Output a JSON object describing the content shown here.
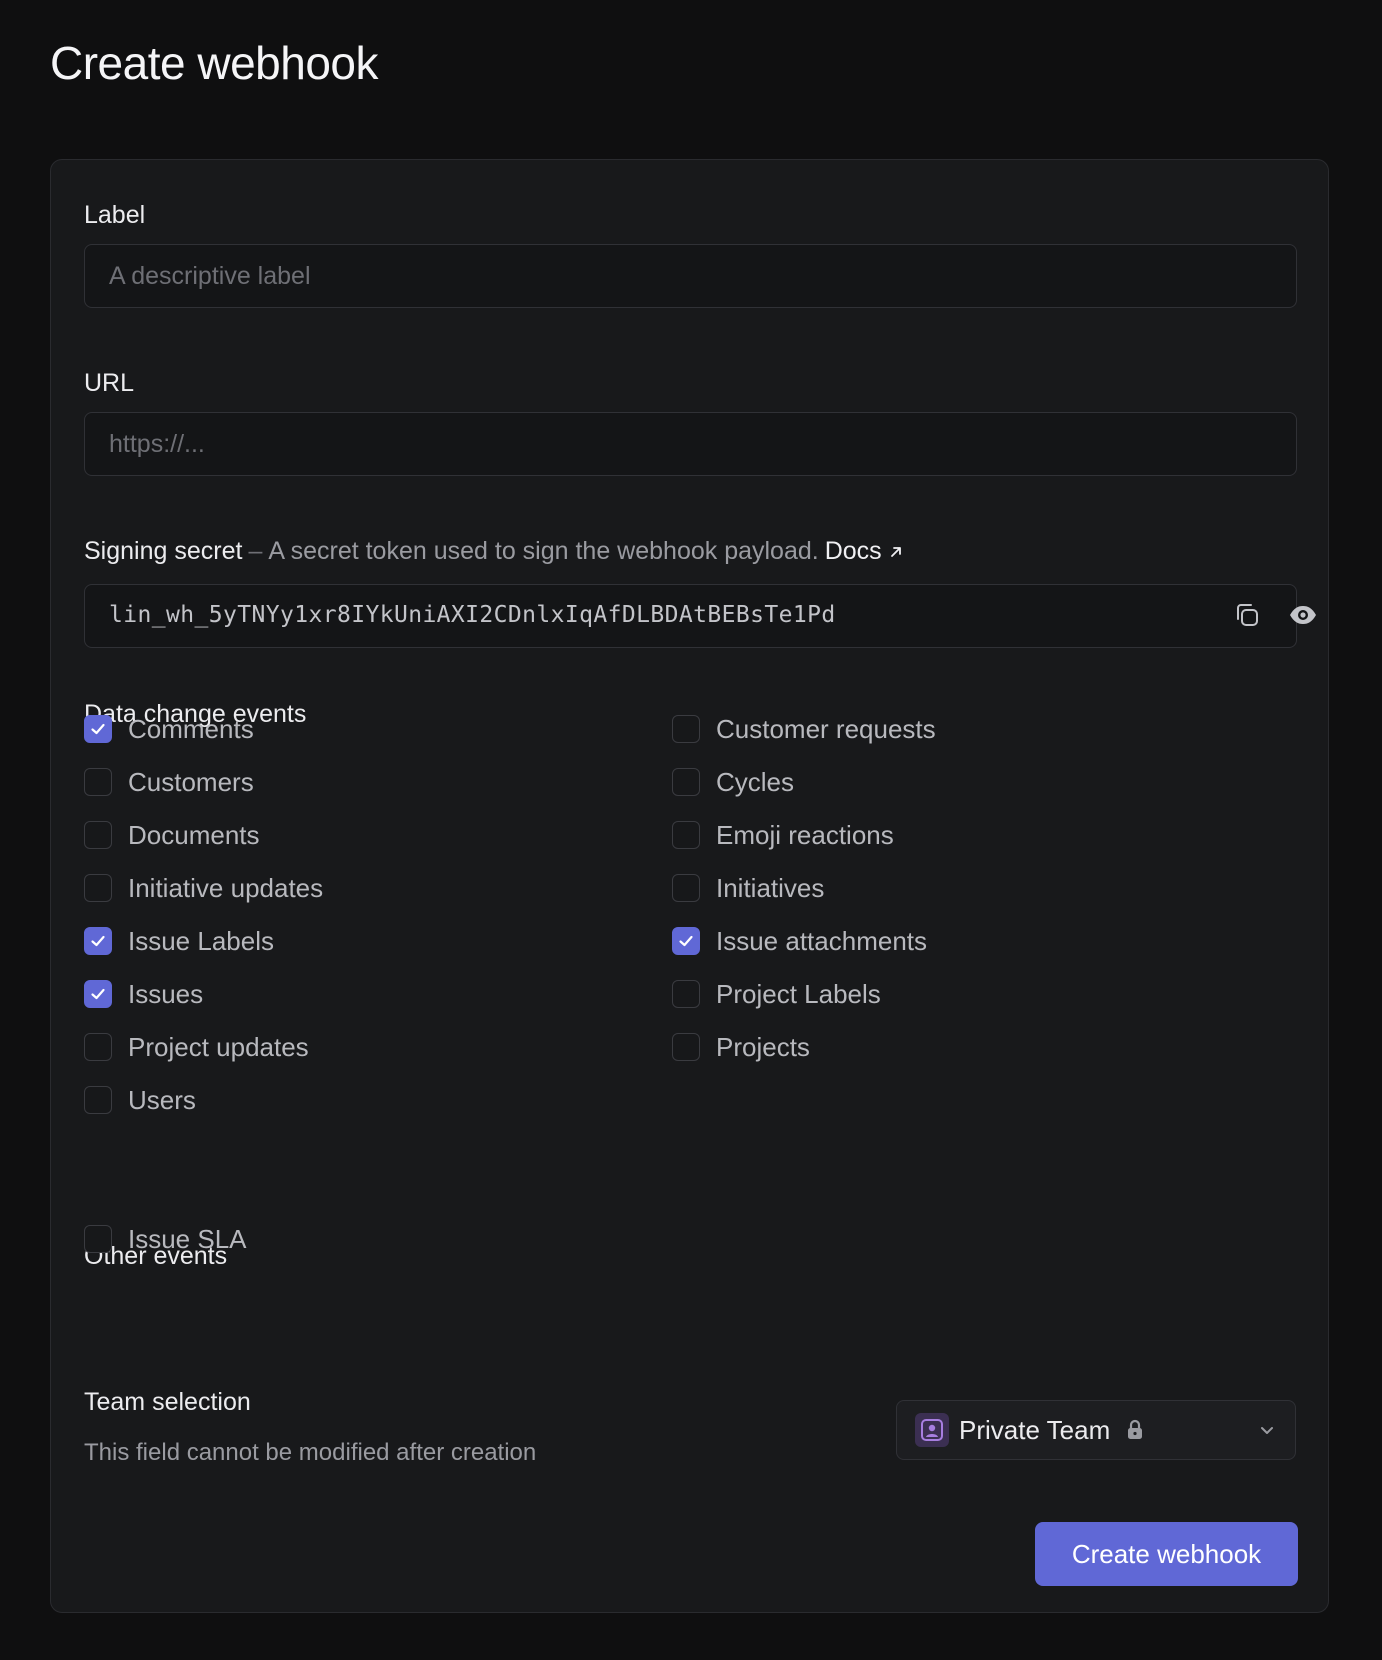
{
  "page": {
    "title": "Create webhook"
  },
  "label_field": {
    "label": "Label",
    "placeholder": "A descriptive label",
    "value": ""
  },
  "url_field": {
    "label": "URL",
    "placeholder": "https://...",
    "value": ""
  },
  "signing_secret": {
    "label": "Signing secret",
    "separator": "–",
    "description": "A secret token used to sign the webhook payload.",
    "docs_link": "Docs",
    "value": "lin_wh_5yTNYy1xr8IYkUniAXI2CDnlxIqAfDLBDAtBEBsTe1Pd",
    "copy_icon": "copy-icon",
    "reveal_icon": "eye-icon"
  },
  "data_change_events": {
    "title": "Data change events",
    "items": [
      {
        "label": "Comments",
        "checked": true
      },
      {
        "label": "Customer requests",
        "checked": false
      },
      {
        "label": "Customers",
        "checked": false
      },
      {
        "label": "Cycles",
        "checked": false
      },
      {
        "label": "Documents",
        "checked": false
      },
      {
        "label": "Emoji reactions",
        "checked": false
      },
      {
        "label": "Initiative updates",
        "checked": false
      },
      {
        "label": "Initiatives",
        "checked": false
      },
      {
        "label": "Issue Labels",
        "checked": true
      },
      {
        "label": "Issue attachments",
        "checked": true
      },
      {
        "label": "Issues",
        "checked": true
      },
      {
        "label": "Project Labels",
        "checked": false
      },
      {
        "label": "Project updates",
        "checked": false
      },
      {
        "label": "Projects",
        "checked": false
      },
      {
        "label": "Users",
        "checked": false
      }
    ]
  },
  "other_events": {
    "title": "Other events",
    "items": [
      {
        "label": "Issue SLA",
        "checked": false
      }
    ]
  },
  "team_selection": {
    "title": "Team selection",
    "subtitle": "This field cannot be modified after creation",
    "selected": "Private Team",
    "avatar_icon": "team-avatar-icon",
    "lock_icon": "lock-icon",
    "chevron_icon": "chevron-down-icon"
  },
  "actions": {
    "create_label": "Create webhook"
  },
  "colors": {
    "accent": "#6068d6",
    "background": "#0f0f10",
    "card": "#18191b",
    "team_avatar": "#a77ee0"
  }
}
